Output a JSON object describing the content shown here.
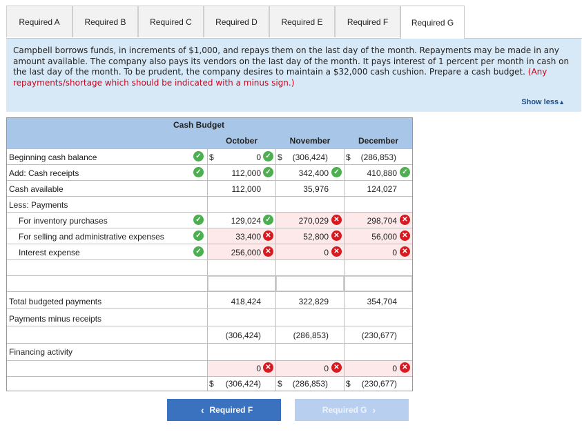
{
  "tabs": [
    {
      "label": "Required A"
    },
    {
      "label": "Required B"
    },
    {
      "label": "Required C"
    },
    {
      "label": "Required D"
    },
    {
      "label": "Required E"
    },
    {
      "label": "Required F"
    },
    {
      "label": "Required G"
    }
  ],
  "instructions": {
    "text": "Campbell borrows funds, in increments of $1,000, and repays them on the last day of the month. Repayments may be made in any amount available. The company also pays its vendors on the last day of the month. It pays interest of 1 percent per month in cash on the last day of the month. To be prudent, the company desires to maintain a $32,000 cash cushion. Prepare a cash budget.",
    "note": "(Any repayments/shortage which should be indicated with a minus sign.)",
    "show_less": "Show less"
  },
  "budget": {
    "title": "Cash Budget",
    "months": [
      "October",
      "November",
      "December"
    ],
    "rows": {
      "beginning": {
        "label": "Beginning cash balance",
        "oct": "0",
        "nov": "(306,424)",
        "dec": "(286,853)",
        "cur": "$"
      },
      "receipts": {
        "label": "Add: Cash receipts",
        "oct": "112,000",
        "nov": "342,400",
        "dec": "410,880"
      },
      "available": {
        "label": "Cash available",
        "oct": "112,000",
        "nov": "35,976",
        "dec": "124,027"
      },
      "less_payments": {
        "label": "Less: Payments"
      },
      "inventory": {
        "label": "For inventory purchases",
        "oct": "129,024",
        "nov": "270,029",
        "dec": "298,704"
      },
      "selling": {
        "label": "For selling and administrative expenses",
        "oct": "33,400",
        "nov": "52,800",
        "dec": "56,000"
      },
      "interest": {
        "label": "Interest expense",
        "oct": "256,000",
        "nov": "0",
        "dec": "0"
      },
      "total": {
        "label": "Total budgeted payments",
        "oct": "418,424",
        "nov": "322,829",
        "dec": "354,704"
      },
      "minus": {
        "label": "Payments minus receipts"
      },
      "minus_vals": {
        "oct": "(306,424)",
        "nov": "(286,853)",
        "dec": "(230,677)"
      },
      "financing": {
        "label": "Financing activity"
      },
      "fin_vals": {
        "oct": "0",
        "nov": "0",
        "dec": "0"
      },
      "ending": {
        "oct": "(306,424)",
        "nov": "(286,853)",
        "dec": "(230,677)",
        "cur": "$"
      }
    }
  },
  "nav": {
    "prev": "Required F",
    "next": "Required G"
  },
  "colors": {
    "header_blue": "#a8c6e8",
    "panel_blue": "#d7e8f6",
    "correct": "#4caf50",
    "incorrect": "#d71920",
    "note_red": "#d0021b"
  }
}
